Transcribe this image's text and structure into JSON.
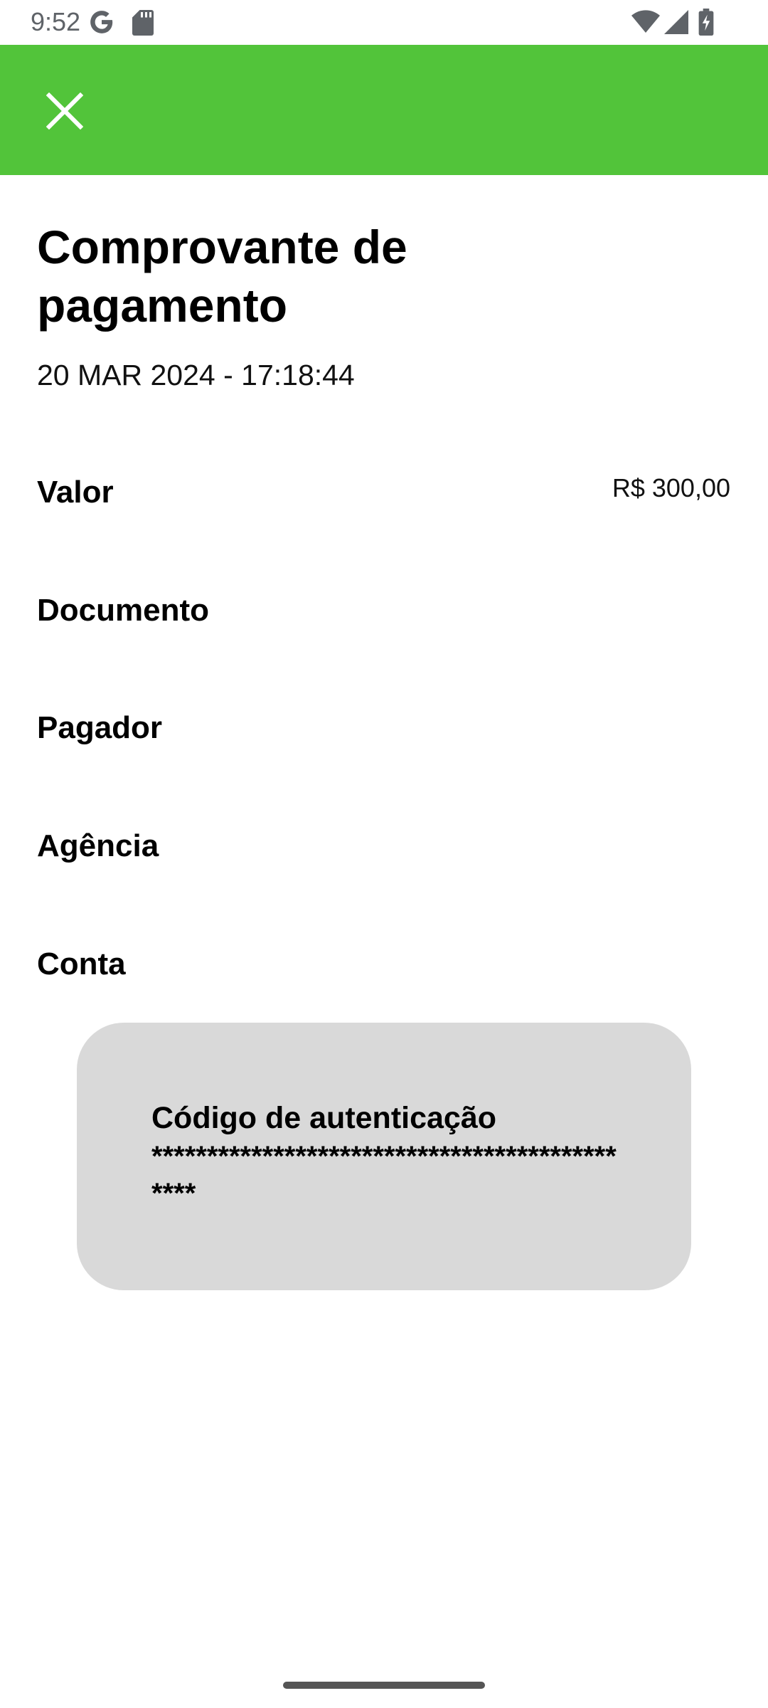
{
  "status_bar": {
    "time": "9:52",
    "icons": [
      "google-icon",
      "sd-card-icon",
      "wifi-icon",
      "signal-icon",
      "battery-charging-icon"
    ]
  },
  "app_bar": {
    "color": "#52c43a",
    "close_icon": "close-icon"
  },
  "receipt": {
    "title": "Comprovante de pagamento",
    "datetime": "20 MAR 2024 - 17:18:44",
    "rows": [
      {
        "label": "Valor",
        "value": "R$ 300,00"
      },
      {
        "label": "Documento",
        "value": ""
      },
      {
        "label": "Pagador",
        "value": ""
      },
      {
        "label": "Agência",
        "value": ""
      },
      {
        "label": "Conta",
        "value": ""
      }
    ],
    "auth": {
      "title": "Código de autenticação",
      "code": "**********************************************"
    }
  }
}
